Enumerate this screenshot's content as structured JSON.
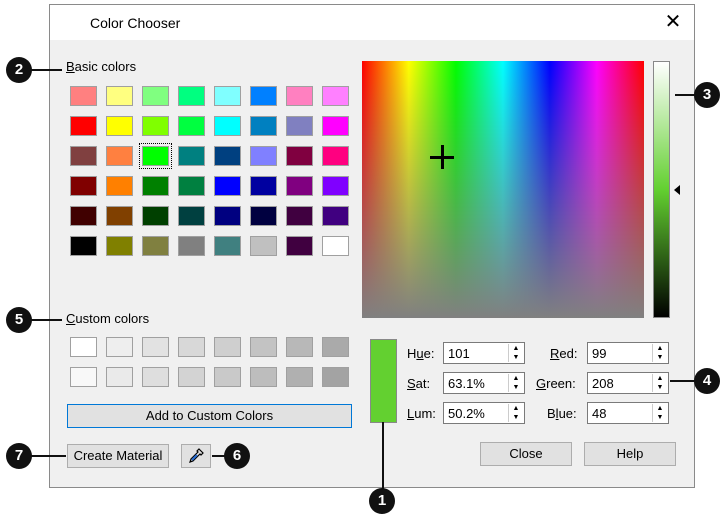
{
  "dialog": {
    "title": "Color Chooser",
    "close_glyph": "✕"
  },
  "basic": {
    "label": "Basic colors",
    "colors": [
      [
        "#ff8080",
        "#ffff80",
        "#80ff80",
        "#00ff80",
        "#80ffff",
        "#0080ff",
        "#ff80c0",
        "#ff80ff"
      ],
      [
        "#ff0000",
        "#ffff00",
        "#80ff00",
        "#00ff40",
        "#00ffff",
        "#0080c0",
        "#8080c0",
        "#ff00ff"
      ],
      [
        "#804040",
        "#ff8040",
        "#00ff00",
        "#008080",
        "#004080",
        "#8080ff",
        "#800040",
        "#ff0080"
      ],
      [
        "#800000",
        "#ff8000",
        "#008000",
        "#008040",
        "#0000ff",
        "#0000a0",
        "#800080",
        "#8000ff"
      ],
      [
        "#400000",
        "#804000",
        "#004000",
        "#004040",
        "#000080",
        "#000040",
        "#400040",
        "#400080"
      ],
      [
        "#000000",
        "#808000",
        "#808040",
        "#808080",
        "#408080",
        "#c0c0c0",
        "#400040",
        "#ffffff"
      ]
    ],
    "selected": "2,2"
  },
  "custom": {
    "label": "Custom colors",
    "colors": [
      [
        "#ffffff",
        "#eeeeee",
        "#e2e2e2",
        "#d8d8d8",
        "#cfcfcf",
        "#c3c3c3",
        "#b8b8b8",
        "#aaaaaa"
      ],
      [
        "#f8f8f8",
        "#eaeaea",
        "#dedede",
        "#d3d3d3",
        "#c9c9c9",
        "#bdbdbd",
        "#b0b0b0",
        "#a3a3a3"
      ]
    ]
  },
  "preview_color": "#63d030",
  "fields": {
    "hue": {
      "label": "Hue:",
      "value": "101"
    },
    "sat": {
      "label": "Sat:",
      "value": "63.1%"
    },
    "lum": {
      "label": "Lum:",
      "value": "50.2%"
    },
    "red": {
      "label": "Red:",
      "value": "99"
    },
    "green": {
      "label": "Green:",
      "value": "208"
    },
    "blue": {
      "label": "Blue:",
      "value": "48"
    }
  },
  "buttons": {
    "add_custom": "Add to Custom Colors",
    "create_material": "Create Material",
    "close": "Close",
    "help": "Help"
  },
  "eyedropper_icon": "eyedropper-icon",
  "callouts": [
    "1",
    "2",
    "3",
    "4",
    "5",
    "6",
    "7"
  ]
}
